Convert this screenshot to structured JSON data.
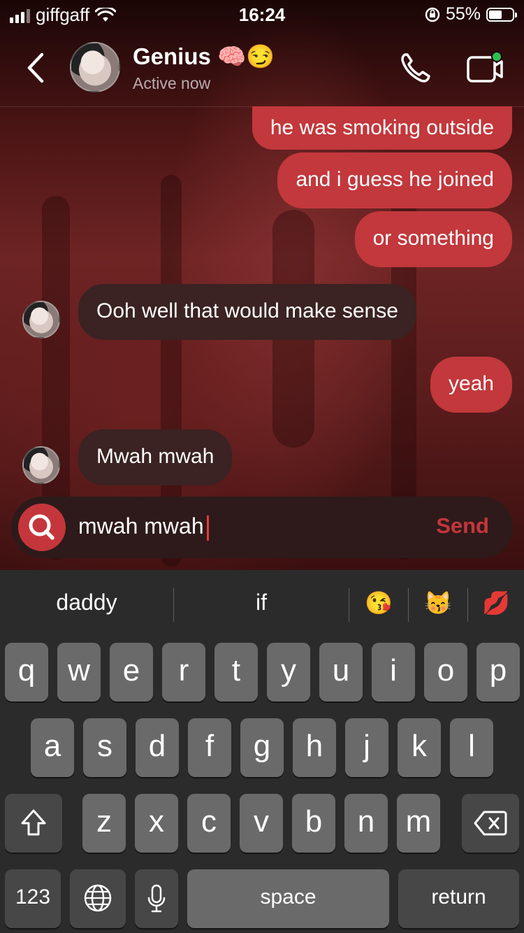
{
  "status": {
    "carrier": "giffgaff",
    "time": "16:24",
    "battery_percent": "55%",
    "battery_level": 0.55
  },
  "header": {
    "contact_name": "Genius 🧠😏",
    "presence": "Active now"
  },
  "messages": [
    {
      "dir": "out",
      "text": "he was smoking outside"
    },
    {
      "dir": "out",
      "text": "and i guess he joined"
    },
    {
      "dir": "out",
      "text": "or something"
    },
    {
      "dir": "in",
      "text": "Ooh well that would make sense"
    },
    {
      "dir": "out",
      "text": "yeah"
    },
    {
      "dir": "in",
      "text": "Mwah mwah"
    }
  ],
  "composer": {
    "value": "mwah mwah",
    "send_label": "Send"
  },
  "suggestions": {
    "word1": "daddy",
    "word2": "if",
    "emoji1": "😘",
    "emoji2": "😽",
    "emoji3": "💋"
  },
  "keyboard": {
    "row1": [
      "q",
      "w",
      "e",
      "r",
      "t",
      "y",
      "u",
      "i",
      "o",
      "p"
    ],
    "row2": [
      "a",
      "s",
      "d",
      "f",
      "g",
      "h",
      "j",
      "k",
      "l"
    ],
    "row3": [
      "z",
      "x",
      "c",
      "v",
      "b",
      "n",
      "m"
    ],
    "numbers_label": "123",
    "space_label": "space",
    "return_label": "return"
  },
  "colors": {
    "outgoing_bubble": "#c2383c",
    "incoming_bubble": "#3a2322",
    "accent": "#c4363b"
  }
}
